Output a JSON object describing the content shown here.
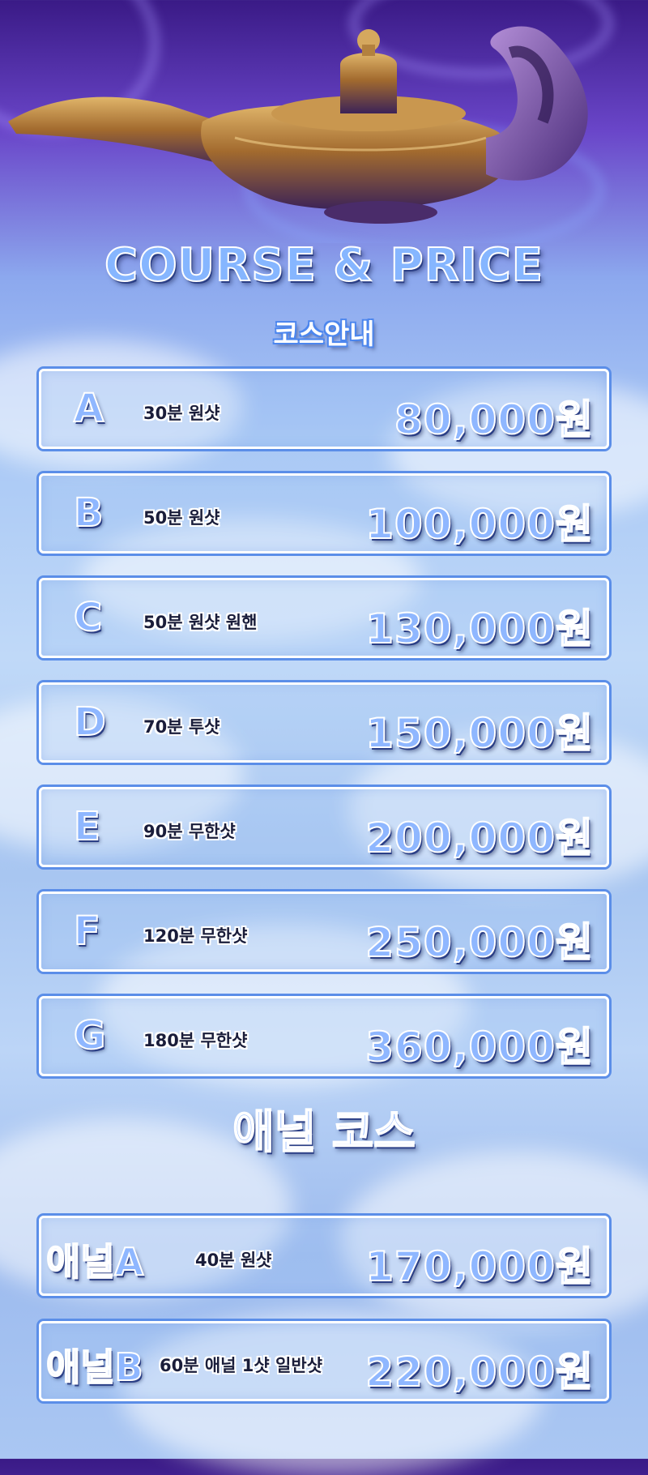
{
  "header": {
    "title_en": "COURSE & PRICE",
    "title_ko": "코스안내"
  },
  "courses": [
    {
      "code": "A",
      "description": "30분 원샷",
      "price": "80,000원"
    },
    {
      "code": "B",
      "description": "50분 원샷",
      "price": "100,000원"
    },
    {
      "code": "C",
      "description": "50분 원샷 원핸",
      "price": "130,000원"
    },
    {
      "code": "D",
      "description": "70분 투샷",
      "price": "150,000원"
    },
    {
      "code": "E",
      "description": "90분 무한샷",
      "price": "200,000원"
    },
    {
      "code": "F",
      "description": "120분 무한샷",
      "price": "250,000원"
    },
    {
      "code": "G",
      "description": "180분 무한샷",
      "price": "360,000원"
    }
  ],
  "anal_section": {
    "title": "애널 코스",
    "courses": [
      {
        "code": "애널A",
        "description": "40분 원샷",
        "price": "170,000원"
      },
      {
        "code": "애널B",
        "description": "60분 애널 1샷 일반샷",
        "price": "220,000원"
      }
    ]
  },
  "colors": {
    "accent": "#8fb7ff",
    "outline": "#ffffff",
    "shadow": "#2b3f86",
    "border": "#5b8ee8"
  },
  "hero_image": "magic-lamp-illustration"
}
